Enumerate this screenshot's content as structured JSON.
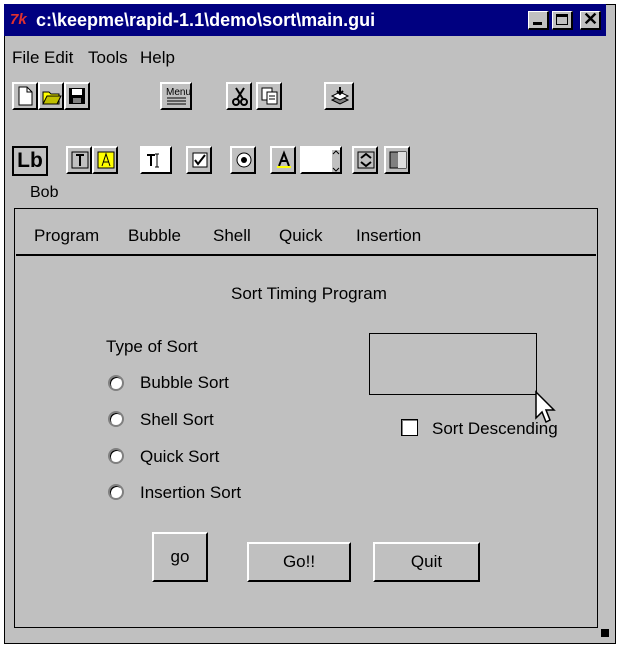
{
  "window": {
    "title": "c:\\keepme\\rapid-1.1\\demo\\sort\\main.gui",
    "app_icon": "tk-icon"
  },
  "menu": [
    "File",
    "Edit",
    "Tools",
    "Help"
  ],
  "toolbar1": [
    "new-file-icon",
    "open-folder-icon",
    "save-disk-icon",
    "menu-editor-icon",
    "cut-scissors-icon",
    "copy-icon",
    "stack-layers-icon"
  ],
  "toolbar2": [
    "label-widget-icon",
    "text-widget-icon",
    "button-widget-icon",
    "entry-widget-icon",
    "checkbox-widget-icon",
    "radiobutton-widget-icon",
    "bitmap-widget-icon",
    "listbox-widget-icon",
    "scrollbar-widget-icon",
    "frame-widget-icon"
  ],
  "toolbar2_label": "Lb",
  "toolbar_menu_label": "Menu",
  "form_name": "Bob",
  "program_menu": [
    "Program",
    "Bubble",
    "Shell",
    "Quick",
    "Insertion"
  ],
  "heading": "Sort Timing Program",
  "sort_group_label": "Type of Sort",
  "sort_options": [
    "Bubble Sort",
    "Shell Sort",
    "Quick Sort",
    "Insertion Sort"
  ],
  "sort_descending_label": "Sort Descending",
  "buttons": {
    "go": "go",
    "go2": "Go!!",
    "quit": "Quit"
  },
  "colors": {
    "titlebar": "#000080",
    "face": "#c0c0c0",
    "tk_icon": "#e03030"
  }
}
